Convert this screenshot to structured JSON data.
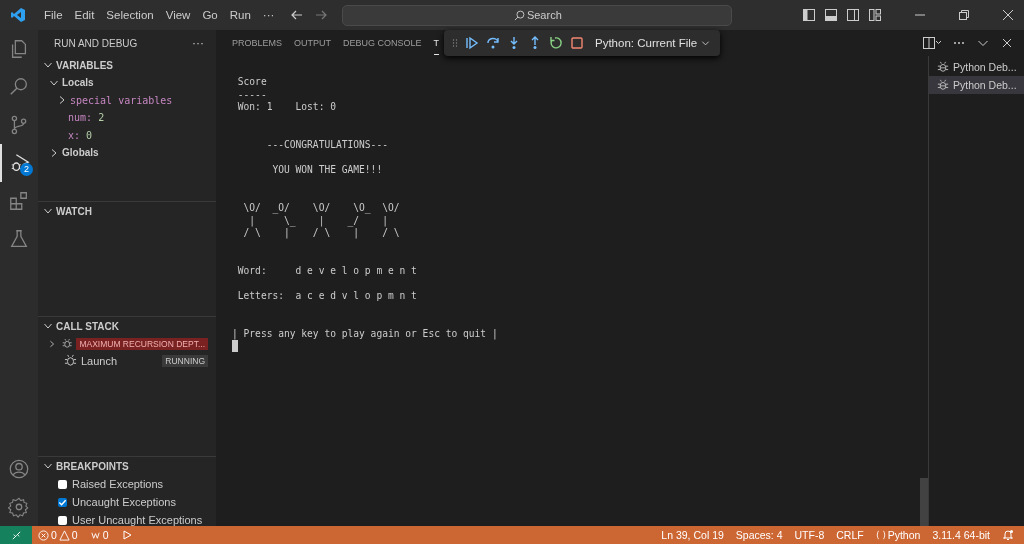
{
  "menu": [
    "File",
    "Edit",
    "Selection",
    "View",
    "Go",
    "Run",
    "···"
  ],
  "search": {
    "placeholder": "Search"
  },
  "activity_bar": {
    "items": [
      {
        "kind": "files",
        "selected": false
      },
      {
        "kind": "search",
        "selected": false
      },
      {
        "kind": "source-control",
        "selected": false
      },
      {
        "kind": "run-debug",
        "selected": true,
        "badge": "2"
      },
      {
        "kind": "extensions",
        "selected": false
      },
      {
        "kind": "testing",
        "selected": false
      }
    ]
  },
  "sidebar": {
    "title": "RUN AND DEBUG",
    "more": "···",
    "variables": {
      "title": "VARIABLES",
      "expanded": true,
      "scopes": [
        {
          "label": "Locals",
          "expanded": true,
          "children": [
            {
              "kind": "group",
              "name": "special variables",
              "expanded": false
            },
            {
              "kind": "var",
              "name": "num:",
              "value": "2"
            },
            {
              "kind": "var",
              "name": "x:",
              "value": "0"
            }
          ]
        },
        {
          "label": "Globals",
          "expanded": false
        }
      ]
    },
    "watch": {
      "title": "WATCH",
      "expanded": true
    },
    "call_stack": {
      "title": "CALL STACK",
      "expanded": true,
      "items": [
        {
          "kind": "error",
          "expanded": false,
          "badge": "MAXIMUM RECURSION DEPT..."
        },
        {
          "kind": "running",
          "label": "Launch",
          "badge": "RUNNING"
        }
      ]
    },
    "breakpoints": {
      "title": "BREAKPOINTS",
      "expanded": true,
      "items": [
        {
          "label": "Raised Exceptions",
          "checked": false
        },
        {
          "label": "Uncaught Exceptions",
          "checked": true
        },
        {
          "label": "User Uncaught Exceptions",
          "checked": false
        }
      ]
    }
  },
  "panel": {
    "tabs": [
      {
        "label": "PROBLEMS",
        "selected": false
      },
      {
        "label": "OUTPUT",
        "selected": false
      },
      {
        "label": "DEBUG CONSOLE",
        "selected": false
      },
      {
        "label": "T",
        "selected": true
      }
    ],
    "debug_toolbar": {
      "buttons": [
        {
          "kind": "continue"
        },
        {
          "kind": "step-over"
        },
        {
          "kind": "step-into"
        },
        {
          "kind": "step-out"
        },
        {
          "kind": "restart"
        },
        {
          "kind": "stop"
        }
      ],
      "configuration": "Python: Current File"
    },
    "terminal": {
      "blocks": [
        [
          " Score",
          " -----",
          " Won: 1    Lost: 0"
        ],
        [
          "      ---CONGRATULATIONS---"
        ],
        [
          "       YOU WON THE GAME!!!"
        ],
        [
          "  \\O/  _O/    \\O/    \\O_  \\O/",
          "   |     \\_    |    _/    |",
          "  / \\    |    / \\    |    / \\"
        ],
        [
          " Word:     d e v e l o p m e n t"
        ],
        [
          " Letters:  a c e d v l o p m n t"
        ],
        [
          "| Press any key to play again or Esc to quit |"
        ]
      ]
    },
    "terminals": [
      {
        "label": "Python Deb...",
        "selected": false
      },
      {
        "label": "Python Deb...",
        "selected": true
      }
    ]
  },
  "status_bar": {
    "errors": "0",
    "warnings": "0",
    "ports": "0",
    "right": [
      "Ln 39, Col 19",
      "Spaces: 4",
      "UTF-8",
      "CRLF",
      "Python",
      "3.11.4 64-bit"
    ]
  }
}
